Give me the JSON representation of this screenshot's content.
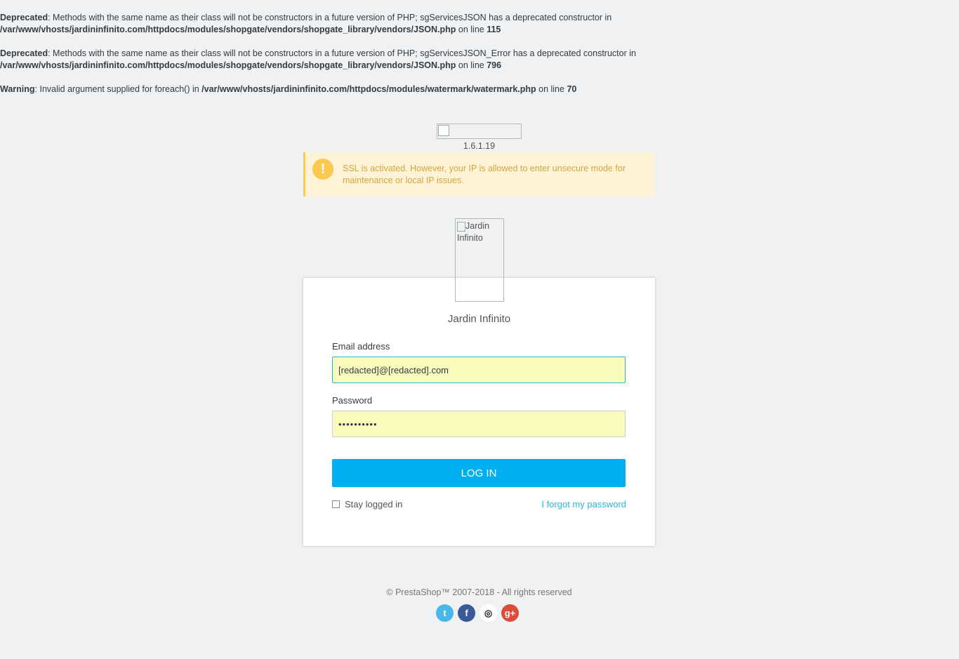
{
  "errors": [
    {
      "type": "Deprecated",
      "msg": ": Methods with the same name as their class will not be constructors in a future version of PHP; sgServicesJSON has a deprecated constructor in",
      "file": "/var/www/vhosts/jardininfinito.com/httpdocs/modules/shopgate/vendors/shopgate_library/vendors/JSON.php",
      "on_line": " on line ",
      "line": "115"
    },
    {
      "type": "Deprecated",
      "msg": ": Methods with the same name as their class will not be constructors in a future version of PHP; sgServicesJSON_Error has a deprecated constructor in",
      "file": "/var/www/vhosts/jardininfinito.com/httpdocs/modules/shopgate/vendors/shopgate_library/vendors/JSON.php",
      "on_line": " on line ",
      "line": "796"
    },
    {
      "type": "Warning",
      "msg": ": Invalid argument supplied for foreach() in ",
      "file": "/var/www/vhosts/jardininfinito.com/httpdocs/modules/watermark/watermark.php",
      "on_line": " on line ",
      "line": "70"
    }
  ],
  "version": "1.6.1.19",
  "alert": {
    "icon": "exclamation-icon",
    "text": "SSL is activated. However, your IP is allowed to enter unsecure mode for maintenance or local IP issues."
  },
  "shop": {
    "logo_alt": "Jardin Infinito",
    "name": "Jardin Infinito"
  },
  "form": {
    "email_label": "Email address",
    "email_value": "[redacted]@[redacted].com",
    "password_label": "Password",
    "password_value": "••••••••••",
    "login_label": "LOG IN",
    "stay_label": "Stay logged in",
    "forgot_label": "I forgot my password"
  },
  "footer": {
    "copyright": "© PrestaShop™ 2007-2018 - All rights reserved"
  },
  "socials": [
    {
      "name": "twitter-icon",
      "glyph": "t"
    },
    {
      "name": "facebook-icon",
      "glyph": "f"
    },
    {
      "name": "github-icon",
      "glyph": "◎"
    },
    {
      "name": "google-plus-icon",
      "glyph": "g+"
    }
  ],
  "colors": {
    "accent": "#00aff0",
    "link": "#25b9d7",
    "warning": "#fcc94f",
    "warning_bg": "#fff3d7"
  }
}
